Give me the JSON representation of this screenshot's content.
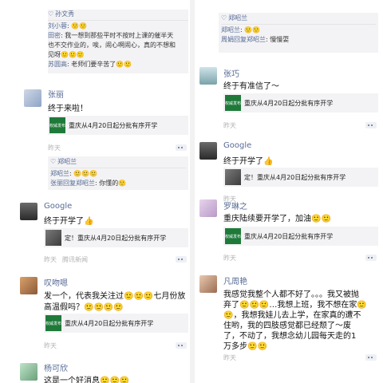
{
  "left": {
    "top_comments": [
      {
        "name": "孙文秀",
        "text": ""
      },
      {
        "name": "刘小蓉",
        "text": ": 🙂🙂"
      },
      {
        "name": "田密",
        "text": ": 我一想到那些平时不按时上课的催半天"
      },
      {
        "name": "",
        "text": "也不交作业的，唉，闹心啊闹心，真的不想和"
      },
      {
        "name": "",
        "text": "见呀🙂🙂🙂"
      },
      {
        "name": "苏圆高",
        "text": ": 老师们要辛苦了🙂🙂"
      }
    ],
    "post1": {
      "name": "张丽",
      "text": "终于来啦！",
      "link": "重庆从4月20日起分批有序开学",
      "thumb": "权威发布",
      "time": "昨天",
      "likes": "郑昭兰",
      "comments": [
        {
          "name": "郑昭兰",
          "text": ": 🙂🙂🙂"
        },
        {
          "name": "张丽回复郑昭兰",
          "text": ": 你懂的🙂"
        }
      ]
    },
    "post2": {
      "name": "Google",
      "text": "终于开学了👍",
      "link": "定！重庆从4月20日起分批有序开学",
      "time": "昨天",
      "source": "腾讯新闻"
    },
    "post3": {
      "name": "叹吻嗯",
      "text1": "发一个，代表我关注过🙂🙂🙂七月份放",
      "text2": "高温假吗？🙂🙂🙂🙂",
      "link": "重庆从4月20日起分批有序开学",
      "thumb": "权威发布",
      "time": "昨天"
    },
    "post4": {
      "name": "杨可欣",
      "text": "这是一个好消息🙂🙂🙂"
    }
  },
  "right": {
    "top": {
      "likes": "郑昭兰",
      "comments": [
        {
          "name": "郑昭兰",
          "text": ": 🙂🙂"
        },
        {
          "name": "周娟回复郑昭兰",
          "text": ": 慢慢耍"
        }
      ]
    },
    "post1": {
      "name": "张巧",
      "text": "终于有准信了～",
      "link": "重庆从4月20日起分批有序开学",
      "thumb": "权威发布",
      "time": "昨天"
    },
    "post2": {
      "name": "Google",
      "text": "终于开学了👍",
      "link": "定！重庆从4月20日起分批有序开学",
      "time": "昨天"
    },
    "post3": {
      "name": "罗琳之",
      "text": "重庆陆续要开学了，加油🙂🙂",
      "link": "重庆从4月20日起分批有序开学",
      "thumb": "权威发布",
      "time": "昨天"
    },
    "post4": {
      "name": "凡周艳",
      "lines": [
        "我感觉我整个人都不好了。。。我又被抛",
        "弃了🙂🙂🙂…我想上班，我不想在家🙂",
        "🙂，我想我娃儿去上学，在家真的遭不",
        "住哟，我的四肢感觉都已经颓了～废",
        "了，不动了，我想念幼儿园每天走的1",
        "万多步🙂🙂"
      ]
    },
    "post4_time": "昨天"
  }
}
